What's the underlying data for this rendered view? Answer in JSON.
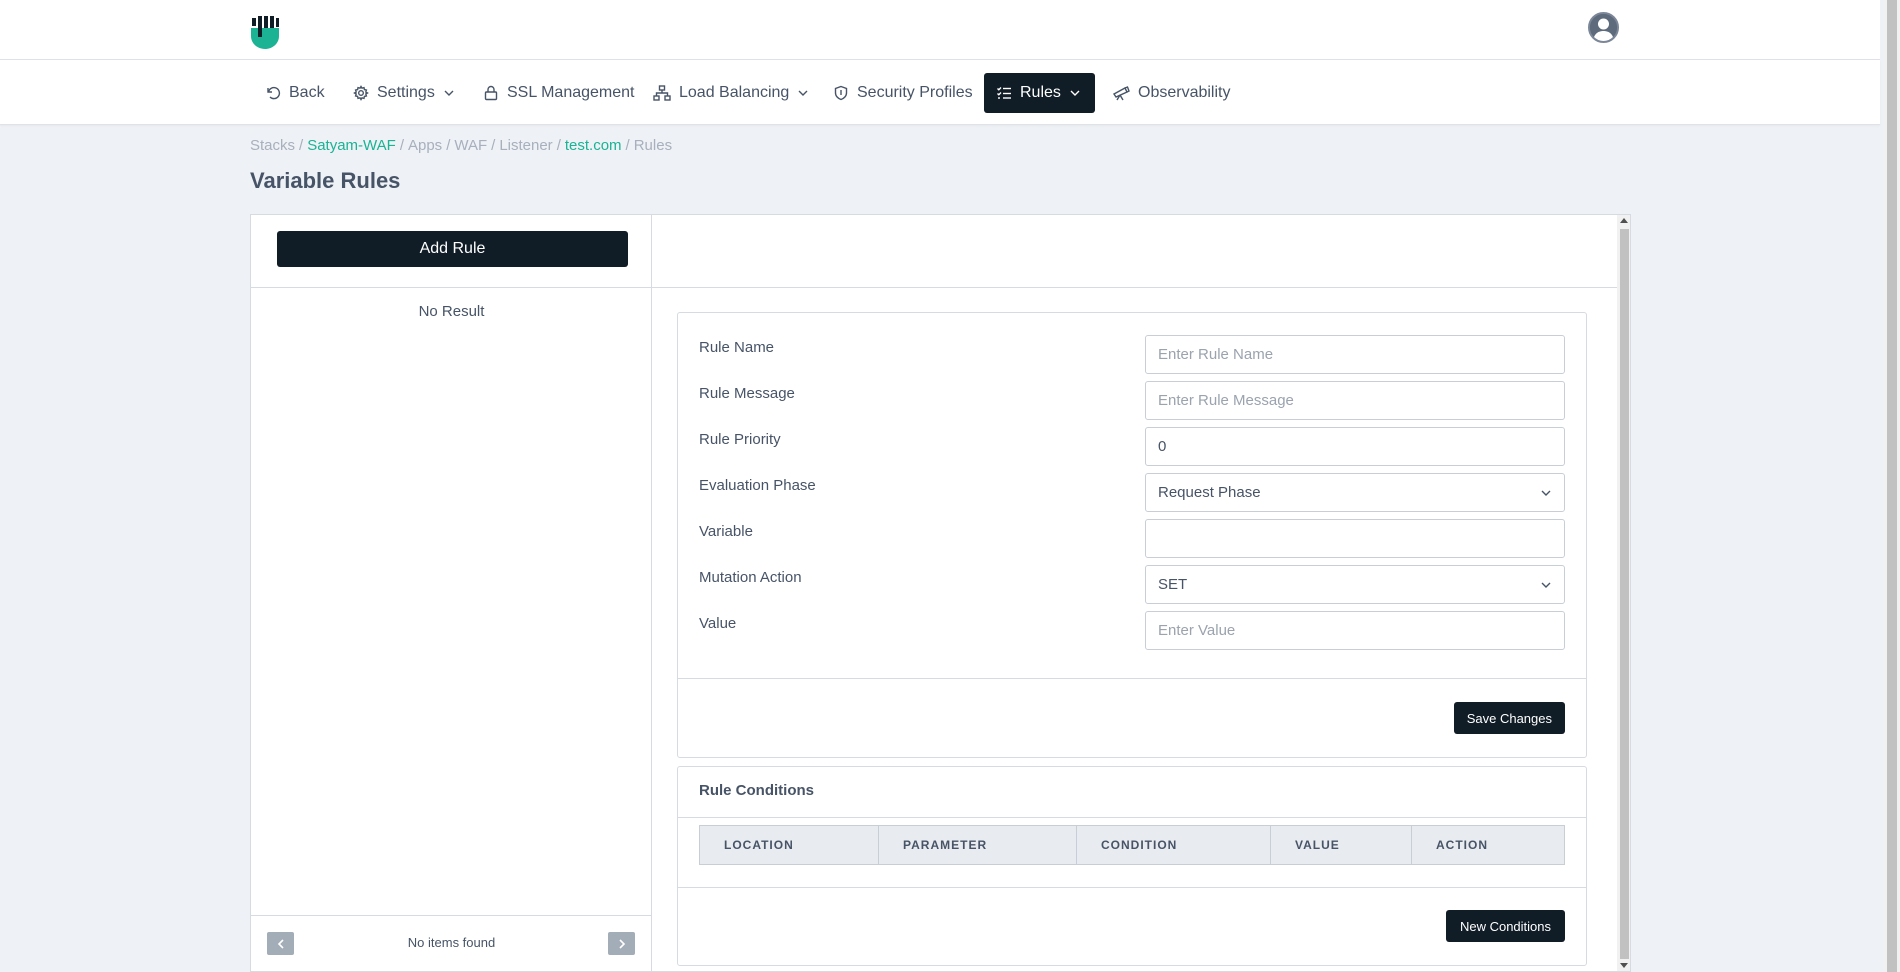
{
  "header": {
    "logo_icon": "fist-logo-icon",
    "avatar_icon": "user-avatar-icon"
  },
  "nav": {
    "back": "Back",
    "settings": "Settings",
    "ssl": "SSL Management",
    "load_balancing": "Load Balancing",
    "security_profiles": "Security Profiles",
    "rules": "Rules",
    "observability": "Observability"
  },
  "breadcrumb": {
    "stacks": "Stacks",
    "stack_name": "Satyam-WAF",
    "apps": "Apps",
    "waf": "WAF",
    "listener": "Listener",
    "domain": "test.com",
    "rules": "Rules",
    "separator": "/"
  },
  "page": {
    "title": "Variable Rules"
  },
  "left": {
    "add_rule": "Add Rule",
    "no_result": "No Result",
    "pager_text": "No items found"
  },
  "form": {
    "rule_name": {
      "label": "Rule Name",
      "placeholder": "Enter Rule Name",
      "value": ""
    },
    "rule_message": {
      "label": "Rule Message",
      "placeholder": "Enter Rule Message",
      "value": ""
    },
    "rule_priority": {
      "label": "Rule Priority",
      "value": "0"
    },
    "evaluation_phase": {
      "label": "Evaluation Phase",
      "value": "Request Phase"
    },
    "variable": {
      "label": "Variable",
      "value": ""
    },
    "mutation_action": {
      "label": "Mutation Action",
      "value": "SET"
    },
    "value": {
      "label": "Value",
      "placeholder": "Enter Value",
      "value": ""
    },
    "save": "Save Changes"
  },
  "conditions": {
    "title": "Rule Conditions",
    "columns": [
      "LOCATION",
      "PARAMETER",
      "CONDITION",
      "VALUE",
      "ACTION"
    ],
    "new_button": "New Conditions"
  },
  "colors": {
    "accent": "#1bb394",
    "dark": "#101c26",
    "text": "#475467",
    "muted": "#a7b0bc"
  }
}
